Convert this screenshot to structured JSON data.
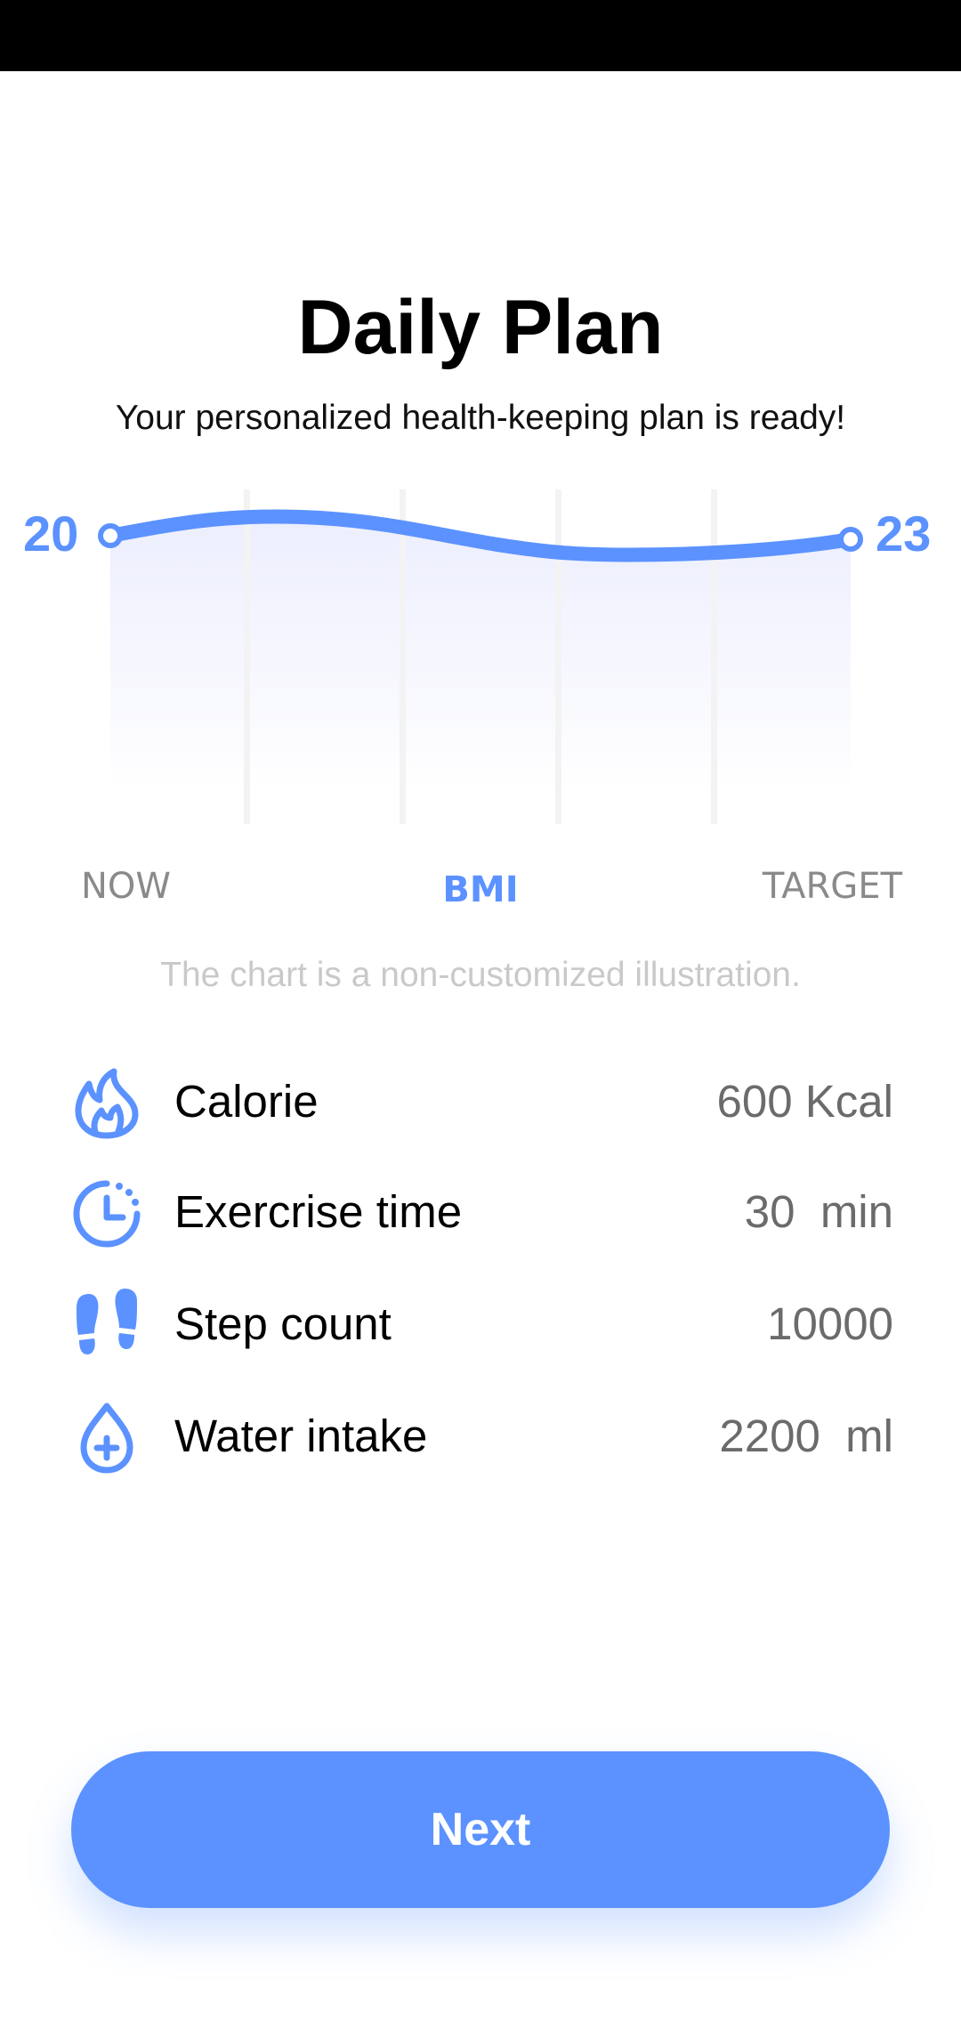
{
  "header": {
    "title": "Daily Plan",
    "subtitle": "Your personalized health-keeping plan is ready!"
  },
  "colors": {
    "accent": "#5b92ff",
    "fill_top": "#eceefd"
  },
  "chart_data": {
    "type": "area",
    "start_value": "20",
    "end_value": "23",
    "x_start_label": "NOW",
    "x_center_label": "BMI",
    "x_end_label": "TARGET",
    "note": "The chart is a non-customized illustration."
  },
  "plan": {
    "items": [
      {
        "icon": "flame-icon",
        "label": "Calorie",
        "value": "600 Kcal"
      },
      {
        "icon": "clock-icon",
        "label": "Exercrise time",
        "value": "30  min"
      },
      {
        "icon": "footprints-icon",
        "label": "Step count",
        "value": "10000"
      },
      {
        "icon": "water-drop-plus-icon",
        "label": "Water intake",
        "value": "2200  ml"
      }
    ]
  },
  "footer": {
    "next_label": "Next"
  }
}
